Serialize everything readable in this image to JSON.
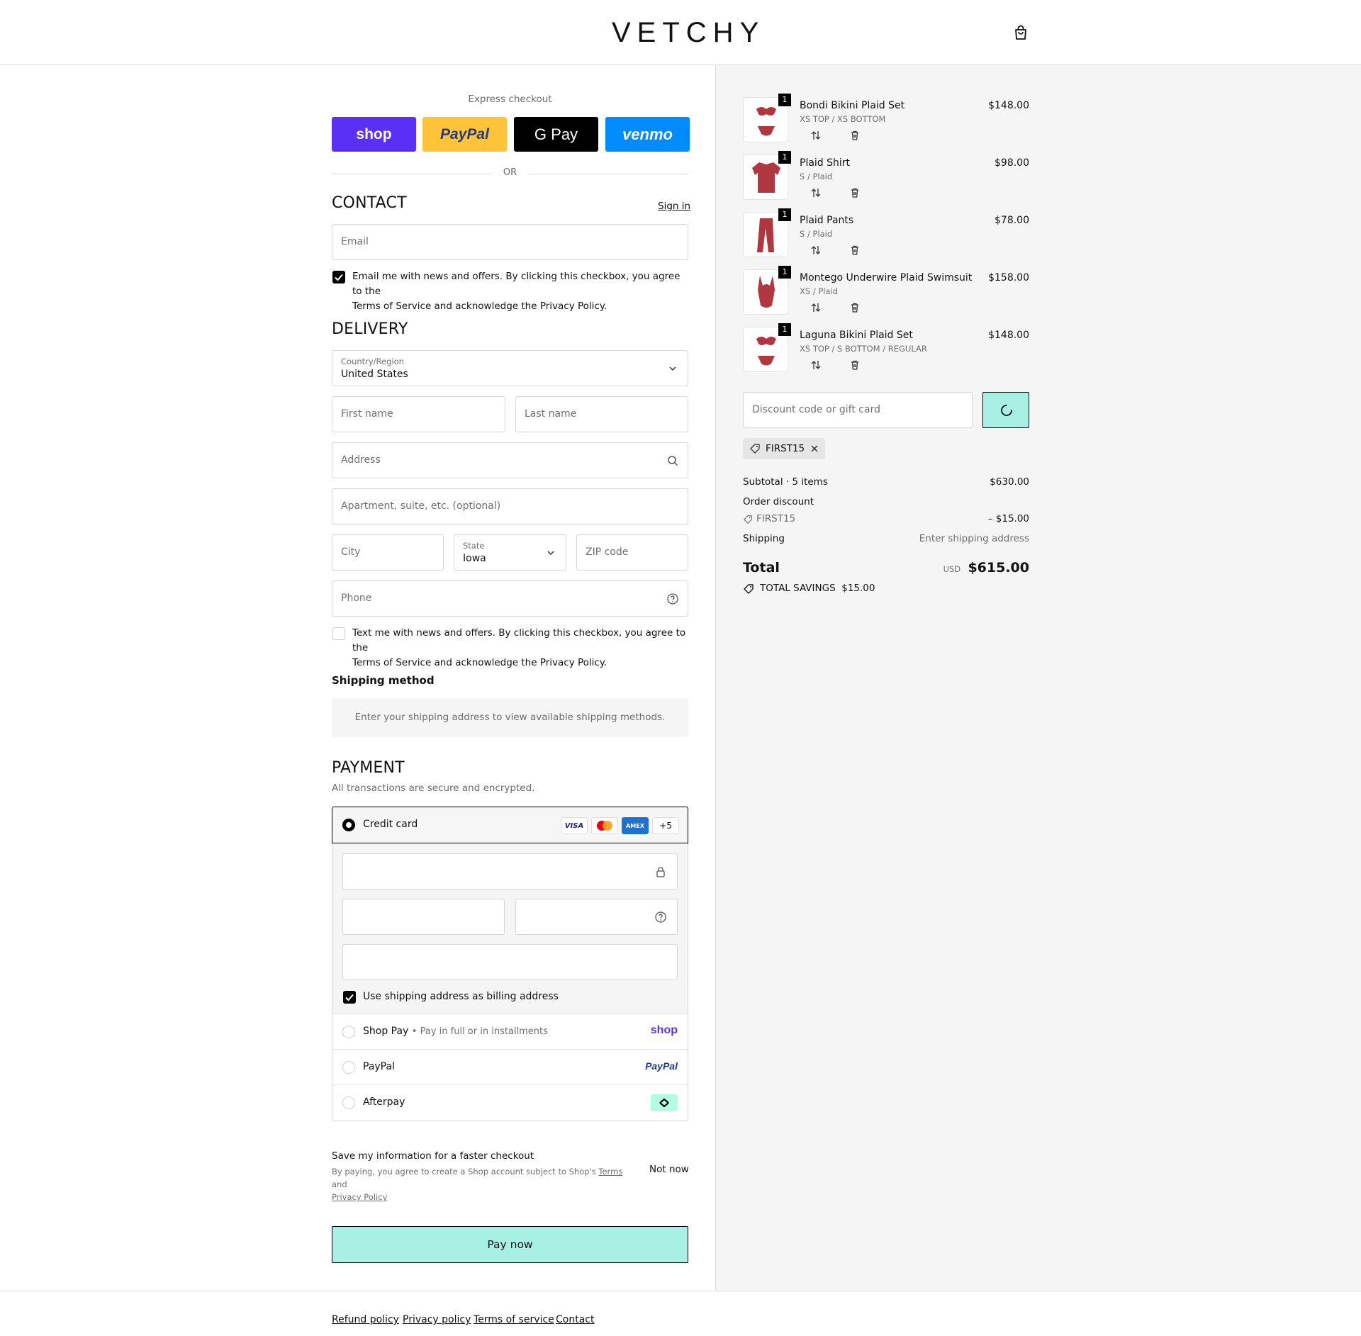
{
  "brand": {
    "name": "VETCHY"
  },
  "express": {
    "title": "Express checkout",
    "buttons": [
      {
        "label": "shop",
        "color": "#5a31f4"
      },
      {
        "label": "PayPal",
        "color": "#ffc439"
      },
      {
        "label": "G Pay",
        "color": "#000000"
      },
      {
        "label": "venmo",
        "color": "#008cff"
      }
    ],
    "or": "OR"
  },
  "contact": {
    "heading": "CONTACT",
    "sign_in": "Sign in",
    "email_placeholder": "Email",
    "newsletter_checked": true,
    "newsletter_text_1": "Email me with news and offers. By clicking this checkbox, you agree to the",
    "newsletter_text_2": "Terms of Service and acknowledge the Privacy Policy."
  },
  "delivery": {
    "heading": "DELIVERY",
    "country_label": "Country/Region",
    "country_value": "United States",
    "first_name": "First name",
    "last_name": "Last name",
    "address": "Address",
    "apartment": "Apartment, suite, etc. (optional)",
    "city": "City",
    "state_label": "State",
    "state_value": "Iowa",
    "zip": "ZIP code",
    "phone": "Phone",
    "sms_checked": false,
    "sms_text_1": "Text me with news and offers. By clicking this checkbox, you agree to the",
    "sms_text_2": "Terms of Service and acknowledge the Privacy Policy."
  },
  "shipping_method": {
    "heading": "Shipping method",
    "note": "Enter your shipping address to view available shipping methods."
  },
  "payment": {
    "heading": "PAYMENT",
    "subtitle": "All transactions are secure and encrypted.",
    "credit_card_label": "Credit card",
    "card_logos": [
      "VISA",
      "mastercard",
      "AMEX"
    ],
    "more_cards": "+5",
    "billing_checked": true,
    "billing_label": "Use shipping address as billing address",
    "options": [
      {
        "label": "Shop Pay",
        "sub": "Pay in full or in installments",
        "logo": "shop"
      },
      {
        "label": "PayPal",
        "sub": "",
        "logo": "PayPal"
      },
      {
        "label": "Afterpay",
        "sub": "",
        "logo": "afterpay"
      }
    ]
  },
  "save_info": {
    "title": "Save my information for a faster checkout",
    "legal_1": "By paying, you agree to create a Shop account subject to Shop's",
    "terms": "Terms",
    "and": "and",
    "privacy": "Privacy Policy",
    "not_now": "Not now"
  },
  "pay_now": "Pay now",
  "footer_links": [
    "Refund policy",
    "Privacy policy",
    "Terms of service",
    "Contact"
  ],
  "cart": {
    "items": [
      {
        "name": "Bondi Bikini Plaid Set",
        "variant": "XS TOP / XS BOTTOM",
        "price": "$148.00",
        "qty": "1",
        "kind": "bikini"
      },
      {
        "name": "Plaid Shirt",
        "variant": "S / Plaid",
        "price": "$98.00",
        "qty": "1",
        "kind": "shirt"
      },
      {
        "name": "Plaid Pants",
        "variant": "S / Plaid",
        "price": "$78.00",
        "qty": "1",
        "kind": "pants"
      },
      {
        "name": "Montego Underwire Plaid Swimsuit",
        "variant": "XS / Plaid",
        "price": "$158.00",
        "qty": "1",
        "kind": "swimsuit"
      },
      {
        "name": "Laguna Bikini Plaid Set",
        "variant": "XS TOP / S BOTTOM / REGULAR",
        "price": "$148.00",
        "qty": "1",
        "kind": "bikini"
      }
    ],
    "discount_placeholder": "Discount code or gift card",
    "applied_code": "FIRST15",
    "subtotal_label": "Subtotal · 5 items",
    "subtotal_value": "$630.00",
    "order_discount_label": "Order discount",
    "discount_code": "FIRST15",
    "discount_value": "– $15.00",
    "shipping_label": "Shipping",
    "shipping_value": "Enter shipping address",
    "total_label": "Total",
    "currency": "USD",
    "total_value": "$615.00",
    "savings_label": "TOTAL SAVINGS",
    "savings_value": "$15.00"
  },
  "colors": {
    "accent": "#a8efe4",
    "plaid": "#b0363f"
  }
}
